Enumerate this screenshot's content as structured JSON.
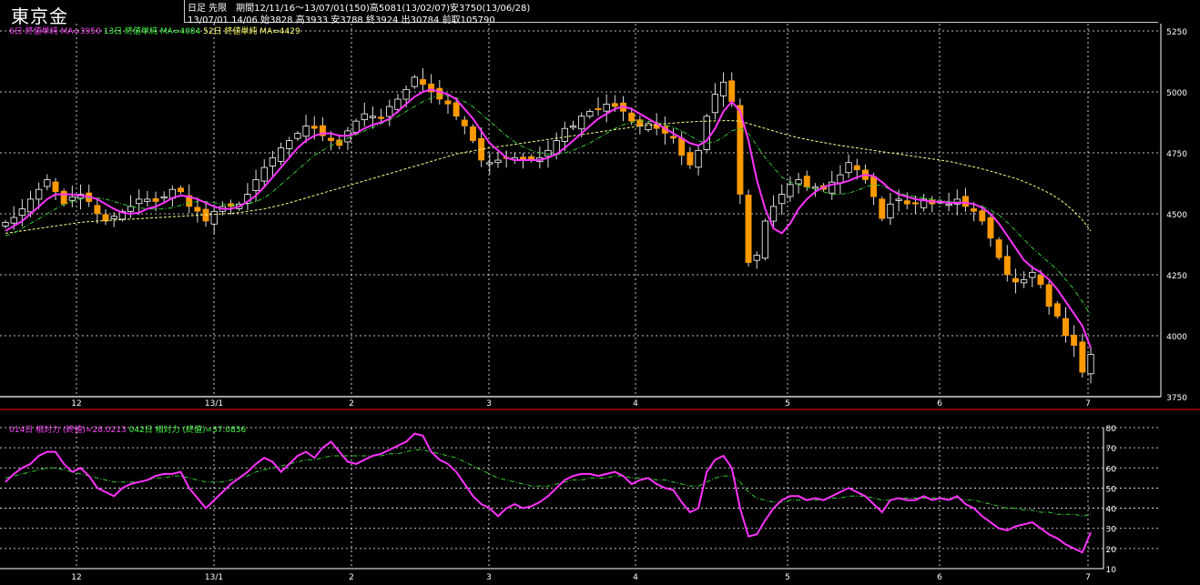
{
  "header": {
    "title": "東京金",
    "info_line1": "日足 先限　期間12/11/16～13/07/01(150)高5081(13/02/07)安3750(13/06/28)",
    "info_line2": "13/07/01 14/06 始3828 高3933 安3788 終3924 出30784 前取105790"
  },
  "upper_legend": [
    {
      "text": "6日 終値単純 MA=3950",
      "color": "#ff44ff"
    },
    {
      "text": "13日 終値単純 MA=4084",
      "color": "#44ff44"
    },
    {
      "text": "52日 終値単純 MA=4429",
      "color": "#ffff66"
    }
  ],
  "lower_legend": [
    {
      "text": "014日 相対力 (終値)=28.0213",
      "color": "#ff44ff"
    },
    {
      "text": "042日 相対力 (終値)=37.0836",
      "color": "#44ff44"
    }
  ],
  "colors": {
    "candle": "#ff9900",
    "ma6": "#ff33ff",
    "ma13": "#33cc33",
    "ma52": "#ffff88",
    "rsi14": "#ff33ff",
    "rsi42": "#33cc33",
    "grid": "#ffffff",
    "divider": "#ff0000"
  },
  "chart_data": [
    {
      "type": "candlestick",
      "title": "東京金",
      "x_labels": [
        "12",
        "13/1",
        "2",
        "3",
        "4",
        "5",
        "6",
        "7"
      ],
      "ylim": [
        3750,
        5250
      ],
      "y_ticks": [
        3750,
        4000,
        4250,
        4500,
        4750,
        5000,
        5250
      ],
      "grid": true,
      "close": [
        4465,
        4485,
        4520,
        4560,
        4600,
        4640,
        4590,
        4540,
        4570,
        4580,
        4550,
        4500,
        4470,
        4490,
        4510,
        4530,
        4560,
        4560,
        4550,
        4570,
        4600,
        4590,
        4530,
        4510,
        4470,
        4510,
        4530,
        4530,
        4540,
        4580,
        4640,
        4690,
        4730,
        4770,
        4800,
        4830,
        4860,
        4850,
        4820,
        4800,
        4780,
        4840,
        4880,
        4910,
        4900,
        4890,
        4940,
        4970,
        5010,
        5060,
        5030,
        5000,
        4970,
        4950,
        4900,
        4860,
        4800,
        4720,
        4710,
        4720,
        4730,
        4730,
        4720,
        4720,
        4730,
        4760,
        4800,
        4850,
        4860,
        4900,
        4920,
        4930,
        4950,
        4940,
        4920,
        4880,
        4860,
        4870,
        4850,
        4830,
        4810,
        4740,
        4700,
        4760,
        4900,
        4990,
        5040,
        4960,
        4580,
        4300,
        4330,
        4470,
        4530,
        4580,
        4620,
        4640,
        4610,
        4610,
        4600,
        4630,
        4660,
        4710,
        4680,
        4640,
        4570,
        4480,
        4540,
        4560,
        4540,
        4540,
        4560,
        4540,
        4550,
        4540,
        4560,
        4530,
        4510,
        4470,
        4400,
        4320,
        4250,
        4220,
        4230,
        4260,
        4210,
        4120,
        4080,
        4000,
        3960,
        3850,
        3924
      ],
      "series": [
        {
          "name": "6日 終値単純",
          "values": [
            4430,
            4450,
            4470,
            4500,
            4530,
            4560,
            4580,
            4580,
            4580,
            4575,
            4570,
            4560,
            4540,
            4520,
            4505,
            4500,
            4505,
            4520,
            4530,
            4545,
            4565,
            4575,
            4570,
            4560,
            4545,
            4530,
            4520,
            4520,
            4530,
            4550,
            4575,
            4610,
            4650,
            4690,
            4730,
            4770,
            4800,
            4820,
            4830,
            4830,
            4820,
            4820,
            4830,
            4850,
            4865,
            4875,
            4890,
            4920,
            4950,
            4980,
            5000,
            5010,
            5000,
            4990,
            4970,
            4930,
            4890,
            4840,
            4790,
            4760,
            4730,
            4720,
            4720,
            4720,
            4720,
            4730,
            4745,
            4770,
            4800,
            4830,
            4860,
            4890,
            4910,
            4930,
            4940,
            4930,
            4910,
            4890,
            4870,
            4850,
            4830,
            4810,
            4790,
            4780,
            4800,
            4850,
            4920,
            4960,
            4920,
            4800,
            4640,
            4520,
            4440,
            4420,
            4460,
            4520,
            4560,
            4590,
            4610,
            4620,
            4625,
            4635,
            4650,
            4660,
            4655,
            4630,
            4600,
            4580,
            4570,
            4560,
            4555,
            4550,
            4550,
            4545,
            4545,
            4545,
            4540,
            4525,
            4500,
            4460,
            4410,
            4360,
            4310,
            4280,
            4260,
            4230,
            4190,
            4140,
            4090,
            4040,
            3950
          ]
        },
        {
          "name": "13日 終値単純",
          "values": [
            4410,
            4420,
            4440,
            4460,
            4480,
            4500,
            4520,
            4540,
            4550,
            4560,
            4565,
            4565,
            4560,
            4550,
            4540,
            4530,
            4525,
            4520,
            4520,
            4520,
            4525,
            4535,
            4545,
            4550,
            4550,
            4545,
            4540,
            4535,
            4535,
            4540,
            4550,
            4565,
            4590,
            4620,
            4650,
            4680,
            4710,
            4740,
            4760,
            4780,
            4795,
            4810,
            4825,
            4840,
            4855,
            4870,
            4885,
            4900,
            4920,
            4940,
            4960,
            4975,
            4985,
            4985,
            4975,
            4960,
            4940,
            4910,
            4880,
            4850,
            4820,
            4795,
            4775,
            4760,
            4750,
            4745,
            4745,
            4750,
            4760,
            4775,
            4790,
            4810,
            4830,
            4850,
            4865,
            4875,
            4880,
            4880,
            4875,
            4865,
            4855,
            4840,
            4820,
            4800,
            4790,
            4795,
            4815,
            4840,
            4850,
            4830,
            4780,
            4730,
            4690,
            4650,
            4630,
            4620,
            4610,
            4600,
            4590,
            4580,
            4580,
            4585,
            4595,
            4610,
            4620,
            4615,
            4600,
            4585,
            4575,
            4570,
            4565,
            4560,
            4555,
            4550,
            4548,
            4545,
            4540,
            4530,
            4515,
            4495,
            4465,
            4430,
            4395,
            4360,
            4330,
            4300,
            4270,
            4230,
            4190,
            4140,
            4084
          ]
        },
        {
          "name": "52日 終値単純",
          "values": [
            4420,
            4425,
            4430,
            4435,
            4440,
            4445,
            4450,
            4455,
            4460,
            4465,
            4468,
            4470,
            4472,
            4474,
            4476,
            4478,
            4480,
            4482,
            4484,
            4486,
            4488,
            4490,
            4492,
            4494,
            4496,
            4498,
            4500,
            4502,
            4505,
            4510,
            4515,
            4520,
            4528,
            4536,
            4545,
            4555,
            4565,
            4575,
            4585,
            4595,
            4605,
            4615,
            4625,
            4635,
            4645,
            4655,
            4665,
            4675,
            4685,
            4695,
            4705,
            4715,
            4725,
            4735,
            4745,
            4752,
            4758,
            4764,
            4770,
            4775,
            4780,
            4785,
            4790,
            4795,
            4800,
            4805,
            4810,
            4815,
            4820,
            4825,
            4830,
            4835,
            4840,
            4845,
            4850,
            4855,
            4860,
            4863,
            4866,
            4869,
            4872,
            4875,
            4877,
            4879,
            4880,
            4881,
            4882,
            4882,
            4880,
            4870,
            4860,
            4850,
            4840,
            4830,
            4820,
            4812,
            4805,
            4798,
            4792,
            4786,
            4780,
            4775,
            4770,
            4765,
            4760,
            4755,
            4750,
            4745,
            4740,
            4735,
            4730,
            4725,
            4720,
            4715,
            4708,
            4700,
            4692,
            4684,
            4675,
            4665,
            4655,
            4645,
            4632,
            4618,
            4602,
            4585,
            4565,
            4540,
            4510,
            4475,
            4429
          ]
        }
      ]
    },
    {
      "type": "line",
      "x_labels": [
        "12",
        "13/1",
        "2",
        "3",
        "4",
        "5",
        "6",
        "7"
      ],
      "ylim": [
        10,
        80
      ],
      "y_ticks": [
        10,
        20,
        30,
        40,
        50,
        60,
        70,
        80
      ],
      "grid": true,
      "series": [
        {
          "name": "014日 相対力 (終値)",
          "values": [
            53,
            57,
            60,
            62,
            66,
            68,
            68,
            62,
            58,
            60,
            56,
            50,
            48,
            46,
            50,
            52,
            53,
            54,
            56,
            57,
            57,
            58,
            50,
            45,
            40,
            44,
            48,
            52,
            55,
            58,
            62,
            65,
            63,
            58,
            62,
            66,
            68,
            65,
            70,
            73,
            68,
            63,
            62,
            64,
            66,
            67,
            69,
            71,
            73,
            77,
            76,
            68,
            64,
            62,
            58,
            52,
            46,
            42,
            40,
            36,
            40,
            42,
            40,
            41,
            43,
            46,
            50,
            54,
            56,
            57,
            57,
            56,
            57,
            58,
            56,
            52,
            54,
            55,
            52,
            50,
            49,
            43,
            38,
            40,
            58,
            64,
            66,
            60,
            40,
            26,
            27,
            34,
            40,
            44,
            46,
            46,
            44,
            45,
            44,
            46,
            48,
            50,
            48,
            46,
            42,
            38,
            44,
            45,
            44,
            44,
            46,
            44,
            45,
            44,
            46,
            42,
            40,
            36,
            33,
            30,
            29,
            31,
            32,
            33,
            30,
            27,
            25,
            22,
            20,
            18,
            28
          ]
        },
        {
          "name": "042日 相対力 (終値)",
          "values": [
            55,
            56,
            57,
            58,
            59,
            60,
            60,
            59,
            58,
            57,
            56,
            55,
            54,
            53,
            53,
            53,
            53,
            54,
            55,
            55,
            56,
            56,
            55,
            54,
            53,
            53,
            53,
            54,
            55,
            56,
            58,
            59,
            60,
            61,
            62,
            63,
            64,
            64,
            65,
            66,
            66,
            66,
            66,
            66,
            66,
            66,
            67,
            67,
            68,
            69,
            69,
            68,
            67,
            66,
            65,
            63,
            61,
            59,
            57,
            55,
            54,
            53,
            52,
            51,
            51,
            51,
            52,
            53,
            54,
            54,
            55,
            55,
            55,
            56,
            56,
            55,
            55,
            55,
            54,
            54,
            53,
            52,
            51,
            51,
            53,
            55,
            56,
            56,
            53,
            48,
            45,
            44,
            43,
            43,
            44,
            44,
            44,
            44,
            44,
            45,
            45,
            46,
            46,
            46,
            45,
            44,
            44,
            45,
            45,
            45,
            45,
            45,
            45,
            45,
            45,
            44,
            44,
            43,
            42,
            41,
            40,
            40,
            39,
            39,
            38,
            38,
            37,
            37,
            37,
            36,
            37
          ]
        }
      ]
    }
  ]
}
